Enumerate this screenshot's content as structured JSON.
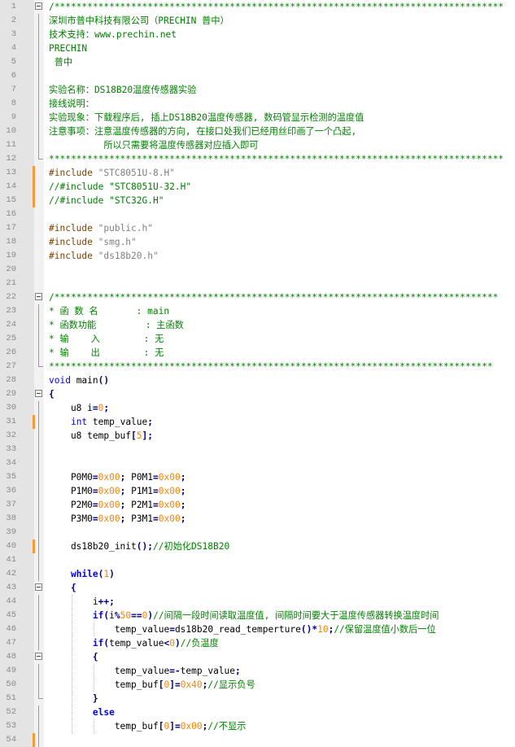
{
  "editor": {
    "lines": [
      {
        "n": "1",
        "tokens": [
          {
            "t": "/**********************************************************************************",
            "c": "cmt"
          }
        ]
      },
      {
        "n": "2",
        "tokens": [
          {
            "t": "深圳市普中科技有限公司（PRECHIN 普中）",
            "c": "cmt"
          }
        ]
      },
      {
        "n": "3",
        "tokens": [
          {
            "t": "技术支持：www.prechin.net",
            "c": "cmt"
          }
        ]
      },
      {
        "n": "4",
        "tokens": [
          {
            "t": "PRECHIN",
            "c": "cmt"
          }
        ]
      },
      {
        "n": "5",
        "tokens": [
          {
            "t": " 普中",
            "c": "cmt"
          }
        ]
      },
      {
        "n": "6",
        "tokens": []
      },
      {
        "n": "7",
        "tokens": [
          {
            "t": "实验名称：DS18B20温度传感器实验",
            "c": "cmt"
          }
        ]
      },
      {
        "n": "8",
        "tokens": [
          {
            "t": "接线说明：",
            "c": "cmt"
          }
        ]
      },
      {
        "n": "9",
        "tokens": [
          {
            "t": "实验现象：下载程序后, 插上DS18B20温度传感器, 数码管显示检测的温度值",
            "c": "cmt"
          }
        ]
      },
      {
        "n": "10",
        "tokens": [
          {
            "t": "注意事项：注意温度传感器的方向, 在接口处我们已经用丝印画了一个凸起,",
            "c": "cmt"
          }
        ]
      },
      {
        "n": "11",
        "tokens": [
          {
            "t": "          所以只需要将温度传感器对应插入即可",
            "c": "cmt"
          }
        ]
      },
      {
        "n": "12",
        "tokens": [
          {
            "t": "***********************************************************************************",
            "c": "cmt"
          }
        ]
      },
      {
        "n": "13",
        "tokens": [
          {
            "t": "#include ",
            "c": "pp"
          },
          {
            "t": "\"STC8051U-8.H\"",
            "c": "str"
          }
        ]
      },
      {
        "n": "14",
        "tokens": [
          {
            "t": "//#include \"STC8051U-32.H\"",
            "c": "cmt"
          }
        ]
      },
      {
        "n": "15",
        "tokens": [
          {
            "t": "//#include \"STC32G.H\"",
            "c": "cmt"
          }
        ]
      },
      {
        "n": "16",
        "tokens": []
      },
      {
        "n": "17",
        "tokens": [
          {
            "t": "#include ",
            "c": "pp"
          },
          {
            "t": "\"public.h\"",
            "c": "str"
          }
        ]
      },
      {
        "n": "18",
        "tokens": [
          {
            "t": "#include ",
            "c": "pp"
          },
          {
            "t": "\"smg.h\"",
            "c": "str"
          }
        ]
      },
      {
        "n": "19",
        "tokens": [
          {
            "t": "#include ",
            "c": "pp"
          },
          {
            "t": "\"ds18b20.h\"",
            "c": "str"
          }
        ]
      },
      {
        "n": "20",
        "tokens": []
      },
      {
        "n": "21",
        "tokens": []
      },
      {
        "n": "22",
        "tokens": [
          {
            "t": "/*********************************************************************************",
            "c": "cmt"
          }
        ]
      },
      {
        "n": "23",
        "tokens": [
          {
            "t": "* 函 数 名       : main",
            "c": "cmt"
          }
        ]
      },
      {
        "n": "24",
        "tokens": [
          {
            "t": "* 函数功能         : 主函数",
            "c": "cmt"
          }
        ]
      },
      {
        "n": "25",
        "tokens": [
          {
            "t": "* 输    入        : 无",
            "c": "cmt"
          }
        ]
      },
      {
        "n": "26",
        "tokens": [
          {
            "t": "* 输    出        : 无",
            "c": "cmt"
          }
        ]
      },
      {
        "n": "27",
        "tokens": [
          {
            "t": "*********************************************************************************",
            "c": "cmt"
          }
        ]
      },
      {
        "n": "28",
        "tokens": [
          {
            "t": "void",
            "c": "kw"
          },
          {
            "t": " main",
            "c": "txt"
          },
          {
            "t": "()",
            "c": "op"
          }
        ]
      },
      {
        "n": "29",
        "tokens": [
          {
            "t": "{",
            "c": "op"
          }
        ]
      },
      {
        "n": "30",
        "tokens": [
          {
            "t": "    u8 i",
            "c": "txt"
          },
          {
            "t": "=",
            "c": "op"
          },
          {
            "t": "0",
            "c": "num"
          },
          {
            "t": ";",
            "c": "op"
          }
        ]
      },
      {
        "n": "31",
        "tokens": [
          {
            "t": "    ",
            "c": "txt"
          },
          {
            "t": "int",
            "c": "kw"
          },
          {
            "t": " temp_value",
            "c": "txt"
          },
          {
            "t": ";",
            "c": "op"
          }
        ]
      },
      {
        "n": "32",
        "tokens": [
          {
            "t": "    u8 temp_buf",
            "c": "txt"
          },
          {
            "t": "[",
            "c": "op"
          },
          {
            "t": "5",
            "c": "num"
          },
          {
            "t": "];",
            "c": "op"
          }
        ]
      },
      {
        "n": "33",
        "tokens": []
      },
      {
        "n": "34",
        "tokens": []
      },
      {
        "n": "35",
        "tokens": [
          {
            "t": "    P0M0",
            "c": "txt"
          },
          {
            "t": "=",
            "c": "op"
          },
          {
            "t": "0x00",
            "c": "num"
          },
          {
            "t": ";",
            "c": "op"
          },
          {
            "t": " P0M1",
            "c": "txt"
          },
          {
            "t": "=",
            "c": "op"
          },
          {
            "t": "0x00",
            "c": "num"
          },
          {
            "t": ";",
            "c": "op"
          }
        ]
      },
      {
        "n": "36",
        "tokens": [
          {
            "t": "    P1M0",
            "c": "txt"
          },
          {
            "t": "=",
            "c": "op"
          },
          {
            "t": "0x00",
            "c": "num"
          },
          {
            "t": ";",
            "c": "op"
          },
          {
            "t": " P1M1",
            "c": "txt"
          },
          {
            "t": "=",
            "c": "op"
          },
          {
            "t": "0x00",
            "c": "num"
          },
          {
            "t": ";",
            "c": "op"
          }
        ]
      },
      {
        "n": "37",
        "tokens": [
          {
            "t": "    P2M0",
            "c": "txt"
          },
          {
            "t": "=",
            "c": "op"
          },
          {
            "t": "0x00",
            "c": "num"
          },
          {
            "t": ";",
            "c": "op"
          },
          {
            "t": " P2M1",
            "c": "txt"
          },
          {
            "t": "=",
            "c": "op"
          },
          {
            "t": "0x00",
            "c": "num"
          },
          {
            "t": ";",
            "c": "op"
          }
        ]
      },
      {
        "n": "38",
        "tokens": [
          {
            "t": "    P3M0",
            "c": "txt"
          },
          {
            "t": "=",
            "c": "op"
          },
          {
            "t": "0x00",
            "c": "num"
          },
          {
            "t": ";",
            "c": "op"
          },
          {
            "t": " P3M1",
            "c": "txt"
          },
          {
            "t": "=",
            "c": "op"
          },
          {
            "t": "0x00",
            "c": "num"
          },
          {
            "t": ";",
            "c": "op"
          }
        ]
      },
      {
        "n": "39",
        "tokens": []
      },
      {
        "n": "40",
        "tokens": [
          {
            "t": "    ds18b20_init",
            "c": "txt"
          },
          {
            "t": "();",
            "c": "op"
          },
          {
            "t": "//初始化DS18B20",
            "c": "cmt"
          }
        ]
      },
      {
        "n": "41",
        "tokens": []
      },
      {
        "n": "42",
        "tokens": [
          {
            "t": "    ",
            "c": "txt"
          },
          {
            "t": "while",
            "c": "bkw"
          },
          {
            "t": "(",
            "c": "op"
          },
          {
            "t": "1",
            "c": "num"
          },
          {
            "t": ")",
            "c": "op"
          }
        ]
      },
      {
        "n": "43",
        "tokens": [
          {
            "t": "    ",
            "c": "txt"
          },
          {
            "t": "{",
            "c": "op"
          }
        ]
      },
      {
        "n": "44",
        "tokens": [
          {
            "t": "        i",
            "c": "txt"
          },
          {
            "t": "++;",
            "c": "op"
          }
        ]
      },
      {
        "n": "45",
        "tokens": [
          {
            "t": "        ",
            "c": "txt"
          },
          {
            "t": "if",
            "c": "bkw"
          },
          {
            "t": "(",
            "c": "op"
          },
          {
            "t": "i",
            "c": "txt"
          },
          {
            "t": "%",
            "c": "op"
          },
          {
            "t": "50",
            "c": "num"
          },
          {
            "t": "==",
            "c": "op"
          },
          {
            "t": "0",
            "c": "num"
          },
          {
            "t": ")",
            "c": "op"
          },
          {
            "t": "//间隔一段时间读取温度值, 间隔时间要大于温度传感器转换温度时间",
            "c": "cmt"
          }
        ]
      },
      {
        "n": "46",
        "tokens": [
          {
            "t": "            temp_value",
            "c": "txt"
          },
          {
            "t": "=",
            "c": "op"
          },
          {
            "t": "ds18b20_read_temperture",
            "c": "txt"
          },
          {
            "t": "()*",
            "c": "op"
          },
          {
            "t": "10",
            "c": "num"
          },
          {
            "t": ";",
            "c": "op"
          },
          {
            "t": "//保留温度值小数后一位",
            "c": "cmt"
          }
        ]
      },
      {
        "n": "47",
        "tokens": [
          {
            "t": "        ",
            "c": "txt"
          },
          {
            "t": "if",
            "c": "bkw"
          },
          {
            "t": "(",
            "c": "op"
          },
          {
            "t": "temp_value",
            "c": "txt"
          },
          {
            "t": "<",
            "c": "op"
          },
          {
            "t": "0",
            "c": "num"
          },
          {
            "t": ")",
            "c": "op"
          },
          {
            "t": "//负温度",
            "c": "cmt"
          }
        ]
      },
      {
        "n": "48",
        "tokens": [
          {
            "t": "        ",
            "c": "txt"
          },
          {
            "t": "{",
            "c": "op"
          }
        ]
      },
      {
        "n": "49",
        "tokens": [
          {
            "t": "            temp_value",
            "c": "txt"
          },
          {
            "t": "=-",
            "c": "op"
          },
          {
            "t": "temp_value",
            "c": "txt"
          },
          {
            "t": ";",
            "c": "op"
          }
        ]
      },
      {
        "n": "50",
        "tokens": [
          {
            "t": "            temp_buf",
            "c": "txt"
          },
          {
            "t": "[",
            "c": "op"
          },
          {
            "t": "0",
            "c": "num"
          },
          {
            "t": "]=",
            "c": "op"
          },
          {
            "t": "0x40",
            "c": "num"
          },
          {
            "t": ";",
            "c": "op"
          },
          {
            "t": "//显示负号",
            "c": "cmt"
          }
        ]
      },
      {
        "n": "51",
        "tokens": [
          {
            "t": "        ",
            "c": "txt"
          },
          {
            "t": "}",
            "c": "op"
          }
        ]
      },
      {
        "n": "52",
        "tokens": [
          {
            "t": "        ",
            "c": "txt"
          },
          {
            "t": "else",
            "c": "bkw"
          }
        ]
      },
      {
        "n": "53",
        "tokens": [
          {
            "t": "            temp_buf",
            "c": "txt"
          },
          {
            "t": "[",
            "c": "op"
          },
          {
            "t": "0",
            "c": "num"
          },
          {
            "t": "]=",
            "c": "op"
          },
          {
            "t": "0x00",
            "c": "num"
          },
          {
            "t": ";",
            "c": "op"
          },
          {
            "t": "//不显示",
            "c": "cmt"
          }
        ]
      },
      {
        "n": "54",
        "tokens": []
      }
    ],
    "changed_lines": [
      "13",
      "14",
      "15",
      "31",
      "40",
      "54"
    ],
    "colors": {
      "comment": "#008000",
      "preprocessor": "#804000",
      "string": "#808080",
      "number": "#ff8000",
      "keyword": "#0000ff",
      "operator": "#000080",
      "change_marker": "#f39a3a",
      "gutter_bg": "#e4e4e4"
    }
  }
}
